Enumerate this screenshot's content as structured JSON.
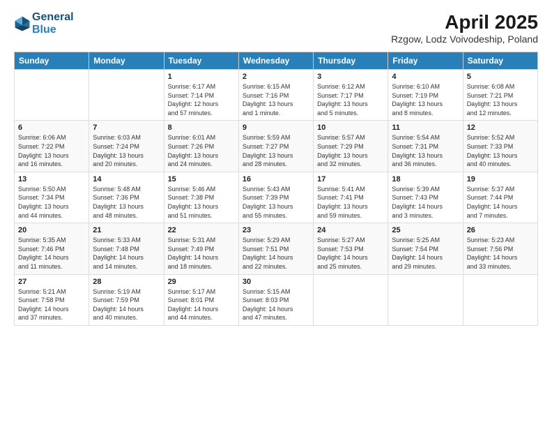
{
  "header": {
    "logo_line1": "General",
    "logo_line2": "Blue",
    "title": "April 2025",
    "subtitle": "Rzgow, Lodz Voivodeship, Poland"
  },
  "columns": [
    "Sunday",
    "Monday",
    "Tuesday",
    "Wednesday",
    "Thursday",
    "Friday",
    "Saturday"
  ],
  "weeks": [
    [
      {
        "day": "",
        "info": ""
      },
      {
        "day": "",
        "info": ""
      },
      {
        "day": "1",
        "info": "Sunrise: 6:17 AM\nSunset: 7:14 PM\nDaylight: 12 hours\nand 57 minutes."
      },
      {
        "day": "2",
        "info": "Sunrise: 6:15 AM\nSunset: 7:16 PM\nDaylight: 13 hours\nand 1 minute."
      },
      {
        "day": "3",
        "info": "Sunrise: 6:12 AM\nSunset: 7:17 PM\nDaylight: 13 hours\nand 5 minutes."
      },
      {
        "day": "4",
        "info": "Sunrise: 6:10 AM\nSunset: 7:19 PM\nDaylight: 13 hours\nand 8 minutes."
      },
      {
        "day": "5",
        "info": "Sunrise: 6:08 AM\nSunset: 7:21 PM\nDaylight: 13 hours\nand 12 minutes."
      }
    ],
    [
      {
        "day": "6",
        "info": "Sunrise: 6:06 AM\nSunset: 7:22 PM\nDaylight: 13 hours\nand 16 minutes."
      },
      {
        "day": "7",
        "info": "Sunrise: 6:03 AM\nSunset: 7:24 PM\nDaylight: 13 hours\nand 20 minutes."
      },
      {
        "day": "8",
        "info": "Sunrise: 6:01 AM\nSunset: 7:26 PM\nDaylight: 13 hours\nand 24 minutes."
      },
      {
        "day": "9",
        "info": "Sunrise: 5:59 AM\nSunset: 7:27 PM\nDaylight: 13 hours\nand 28 minutes."
      },
      {
        "day": "10",
        "info": "Sunrise: 5:57 AM\nSunset: 7:29 PM\nDaylight: 13 hours\nand 32 minutes."
      },
      {
        "day": "11",
        "info": "Sunrise: 5:54 AM\nSunset: 7:31 PM\nDaylight: 13 hours\nand 36 minutes."
      },
      {
        "day": "12",
        "info": "Sunrise: 5:52 AM\nSunset: 7:33 PM\nDaylight: 13 hours\nand 40 minutes."
      }
    ],
    [
      {
        "day": "13",
        "info": "Sunrise: 5:50 AM\nSunset: 7:34 PM\nDaylight: 13 hours\nand 44 minutes."
      },
      {
        "day": "14",
        "info": "Sunrise: 5:48 AM\nSunset: 7:36 PM\nDaylight: 13 hours\nand 48 minutes."
      },
      {
        "day": "15",
        "info": "Sunrise: 5:46 AM\nSunset: 7:38 PM\nDaylight: 13 hours\nand 51 minutes."
      },
      {
        "day": "16",
        "info": "Sunrise: 5:43 AM\nSunset: 7:39 PM\nDaylight: 13 hours\nand 55 minutes."
      },
      {
        "day": "17",
        "info": "Sunrise: 5:41 AM\nSunset: 7:41 PM\nDaylight: 13 hours\nand 59 minutes."
      },
      {
        "day": "18",
        "info": "Sunrise: 5:39 AM\nSunset: 7:43 PM\nDaylight: 14 hours\nand 3 minutes."
      },
      {
        "day": "19",
        "info": "Sunrise: 5:37 AM\nSunset: 7:44 PM\nDaylight: 14 hours\nand 7 minutes."
      }
    ],
    [
      {
        "day": "20",
        "info": "Sunrise: 5:35 AM\nSunset: 7:46 PM\nDaylight: 14 hours\nand 11 minutes."
      },
      {
        "day": "21",
        "info": "Sunrise: 5:33 AM\nSunset: 7:48 PM\nDaylight: 14 hours\nand 14 minutes."
      },
      {
        "day": "22",
        "info": "Sunrise: 5:31 AM\nSunset: 7:49 PM\nDaylight: 14 hours\nand 18 minutes."
      },
      {
        "day": "23",
        "info": "Sunrise: 5:29 AM\nSunset: 7:51 PM\nDaylight: 14 hours\nand 22 minutes."
      },
      {
        "day": "24",
        "info": "Sunrise: 5:27 AM\nSunset: 7:53 PM\nDaylight: 14 hours\nand 25 minutes."
      },
      {
        "day": "25",
        "info": "Sunrise: 5:25 AM\nSunset: 7:54 PM\nDaylight: 14 hours\nand 29 minutes."
      },
      {
        "day": "26",
        "info": "Sunrise: 5:23 AM\nSunset: 7:56 PM\nDaylight: 14 hours\nand 33 minutes."
      }
    ],
    [
      {
        "day": "27",
        "info": "Sunrise: 5:21 AM\nSunset: 7:58 PM\nDaylight: 14 hours\nand 37 minutes."
      },
      {
        "day": "28",
        "info": "Sunrise: 5:19 AM\nSunset: 7:59 PM\nDaylight: 14 hours\nand 40 minutes."
      },
      {
        "day": "29",
        "info": "Sunrise: 5:17 AM\nSunset: 8:01 PM\nDaylight: 14 hours\nand 44 minutes."
      },
      {
        "day": "30",
        "info": "Sunrise: 5:15 AM\nSunset: 8:03 PM\nDaylight: 14 hours\nand 47 minutes."
      },
      {
        "day": "",
        "info": ""
      },
      {
        "day": "",
        "info": ""
      },
      {
        "day": "",
        "info": ""
      }
    ]
  ]
}
